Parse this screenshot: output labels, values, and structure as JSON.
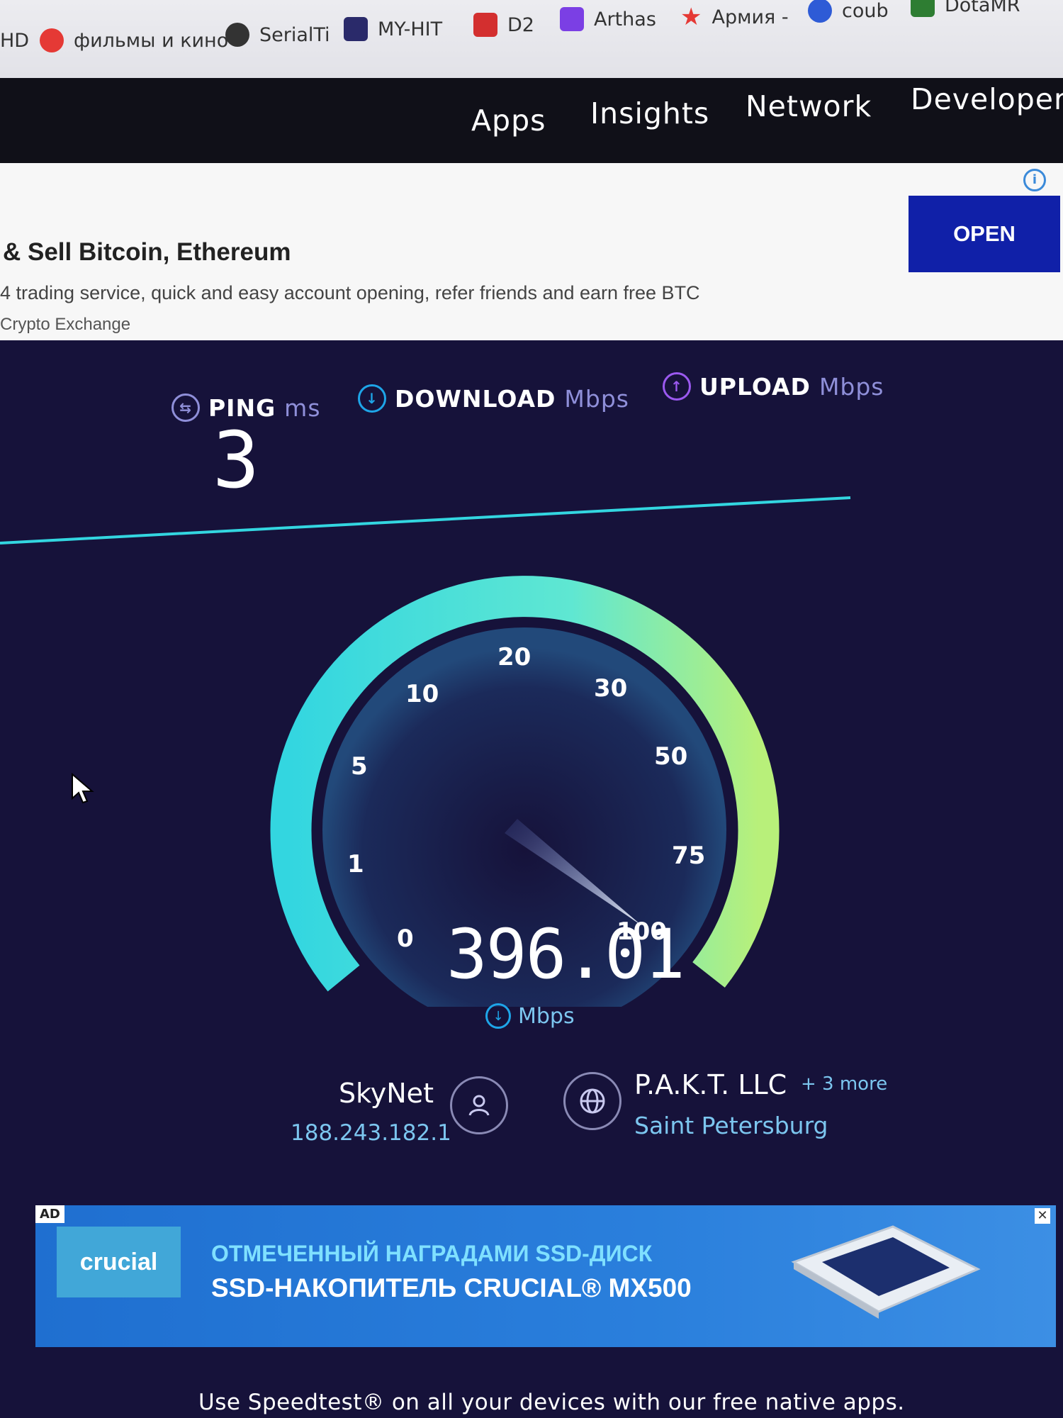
{
  "bookmarks": [
    {
      "label": "HD",
      "color": "#2b7bd6"
    },
    {
      "label": "фильмы и кино",
      "color": "#e53935"
    },
    {
      "label": "SerialTi",
      "color": "#333333"
    },
    {
      "label": "MY-HIT",
      "color": "#2a2a6a"
    },
    {
      "label": "D2",
      "color": "#d32f2f"
    },
    {
      "label": "Arthas",
      "color": "#7b3fe4"
    },
    {
      "label": "Армия -",
      "color": "#e53935"
    },
    {
      "label": "coub",
      "color": "#2e5bd6"
    },
    {
      "label": "DotaMR",
      "color": "#2e7d32"
    }
  ],
  "nav": {
    "apps": "Apps",
    "insights": "Insights",
    "network": "Network",
    "developers": "Developers"
  },
  "ad_top": {
    "headline": "& Sell Bitcoin, Ethereum",
    "subtitle": "4 trading service, quick and easy account opening, refer friends and earn free BTC",
    "source": "Crypto Exchange",
    "cta": "OPEN"
  },
  "stats": {
    "ping_label": "PING",
    "ping_unit": "ms",
    "ping_value": "3",
    "download_label": "DOWNLOAD",
    "download_unit": "Mbps",
    "upload_label": "UPLOAD",
    "upload_unit": "Mbps"
  },
  "gauge": {
    "ticks": [
      "0",
      "1",
      "5",
      "10",
      "20",
      "30",
      "50",
      "75",
      "100"
    ],
    "current_value": "396.01",
    "unit": "Mbps"
  },
  "isp": {
    "name": "SkyNet",
    "ip": "188.243.182.1"
  },
  "server": {
    "name": "P.A.K.T. LLC",
    "more": "+ 3 more",
    "location": "Saint Petersburg"
  },
  "ad_bottom": {
    "tag": "AD",
    "brand": "crucial",
    "line1": "ОТМЕЧЕННЫЙ НАГРАДАМИ SSD-ДИСК",
    "line2": "SSD-НАКОПИТЕЛЬ CRUCIAL® MX500"
  },
  "footer": "Use Speedtest® on all your devices with our free native apps.",
  "colors": {
    "background": "#16123a",
    "accent_cyan": "#33d6e0",
    "accent_green": "#a8f07a",
    "download_blue": "#1ea5e8",
    "upload_purple": "#9b59f0"
  }
}
